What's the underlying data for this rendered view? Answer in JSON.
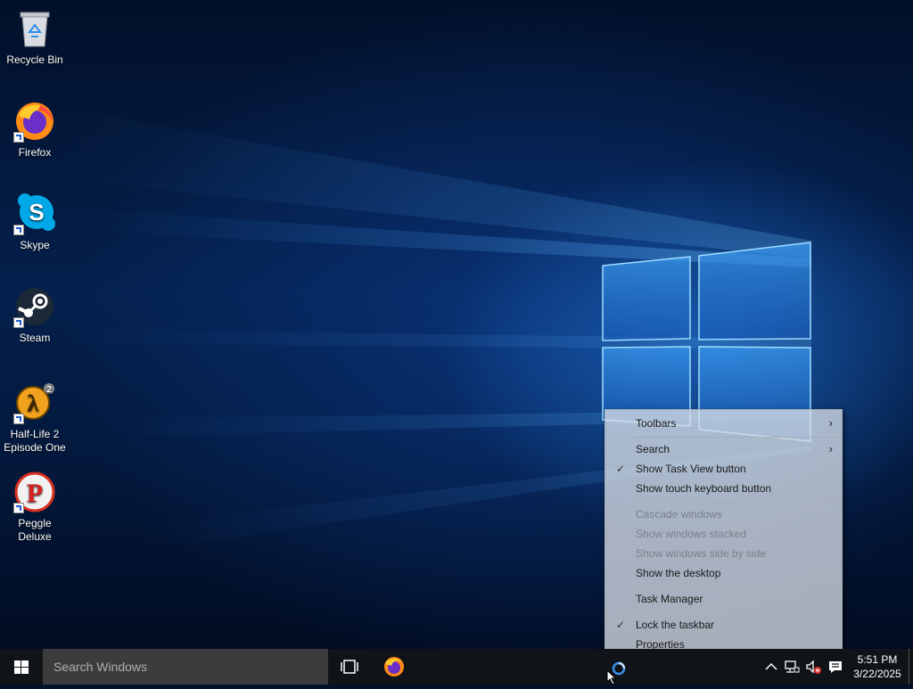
{
  "desktop": {
    "icons": [
      {
        "label": "Recycle Bin",
        "icon": "recycle-bin-icon"
      },
      {
        "label": "Firefox",
        "icon": "firefox-icon"
      },
      {
        "label": "Skype",
        "icon": "skype-icon"
      },
      {
        "label": "Steam",
        "icon": "steam-icon"
      },
      {
        "label": "Half-Life 2 Episode One",
        "icon": "half-life-2-icon"
      },
      {
        "label": "Peggle Deluxe",
        "icon": "peggle-icon"
      }
    ]
  },
  "context_menu": {
    "items": [
      {
        "label": "Toolbars",
        "submenu": true,
        "checked": false,
        "enabled": true
      },
      {
        "label": "Search",
        "submenu": true,
        "checked": false,
        "enabled": true
      },
      {
        "label": "Show Task View button",
        "submenu": false,
        "checked": true,
        "enabled": true
      },
      {
        "label": "Show touch keyboard button",
        "submenu": false,
        "checked": false,
        "enabled": true
      },
      {
        "label": "Cascade windows",
        "submenu": false,
        "checked": false,
        "enabled": false
      },
      {
        "label": "Show windows stacked",
        "submenu": false,
        "checked": false,
        "enabled": false
      },
      {
        "label": "Show windows side by side",
        "submenu": false,
        "checked": false,
        "enabled": false
      },
      {
        "label": "Show the desktop",
        "submenu": false,
        "checked": false,
        "enabled": true
      },
      {
        "label": "Task Manager",
        "submenu": false,
        "checked": false,
        "enabled": true
      },
      {
        "label": "Lock the taskbar",
        "submenu": false,
        "checked": true,
        "enabled": true
      },
      {
        "label": "Properties",
        "submenu": false,
        "checked": false,
        "enabled": true
      }
    ],
    "check_glyph": "✓",
    "submenu_glyph": "›"
  },
  "taskbar": {
    "search_placeholder": "Search Windows",
    "time": "5:51 PM",
    "date": "3/22/2025",
    "tray_icons": [
      "chevron-up-icon",
      "network-icon",
      "volume-muted-icon",
      "action-center-icon"
    ],
    "pinned": [
      "task-view-icon",
      "firefox-icon"
    ]
  },
  "colors": {
    "taskbar_bg": "#101317",
    "accent": "#2b8ff0"
  }
}
